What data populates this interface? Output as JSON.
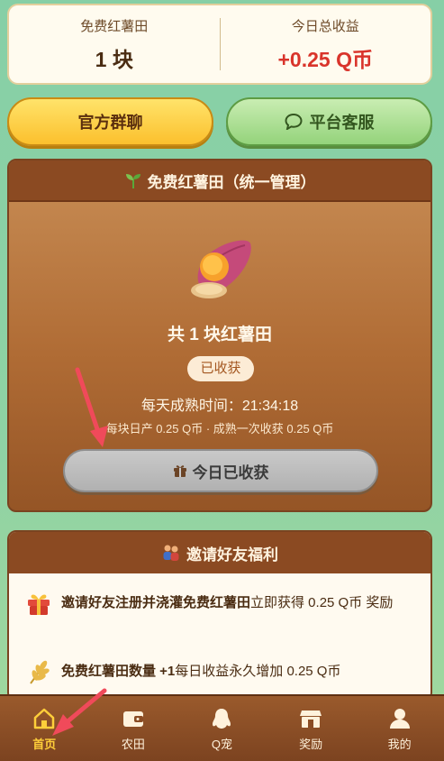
{
  "stats": {
    "free_field_label": "免费红薯田",
    "free_field_value": "1 块",
    "total_income_label": "今日总收益",
    "total_income_value": "+0.25 Q币"
  },
  "actions": {
    "group_chat": "官方群聊",
    "customer_service": "平台客服"
  },
  "field_card": {
    "title": "免费红薯田（统一管理）",
    "count_text": "共 1 块红薯田",
    "status_badge": "已收获",
    "ripen_time": "每天成熟时间：21:34:18",
    "yield_text": "每块日产 0.25 Q币 · 成熟一次收获 0.25 Q币",
    "harvest_button": "今日已收获"
  },
  "invite_card": {
    "title": "邀请好友福利",
    "perks": [
      {
        "bold": "邀请好友注册并浇灌免费红薯田",
        "rest": "立即获得 0.25 Q币 奖励",
        "icon": "gift-icon"
      },
      {
        "bold": "免费红薯田数量 +1",
        "rest": "每日收益永久增加 0.25 Q币",
        "icon": "wheat-icon"
      }
    ]
  },
  "tabbar": {
    "items": [
      {
        "label": "首页",
        "icon": "home-icon",
        "active": true
      },
      {
        "label": "农田",
        "icon": "wallet-icon",
        "active": false
      },
      {
        "label": "Q宠",
        "icon": "penguin-icon",
        "active": false
      },
      {
        "label": "奖励",
        "icon": "shop-icon",
        "active": false
      },
      {
        "label": "我的",
        "icon": "user-icon",
        "active": false
      }
    ]
  },
  "colors": {
    "accent_red": "#d9342b",
    "brown": "#8b4a22",
    "active_tab": "#ffcf3a"
  }
}
